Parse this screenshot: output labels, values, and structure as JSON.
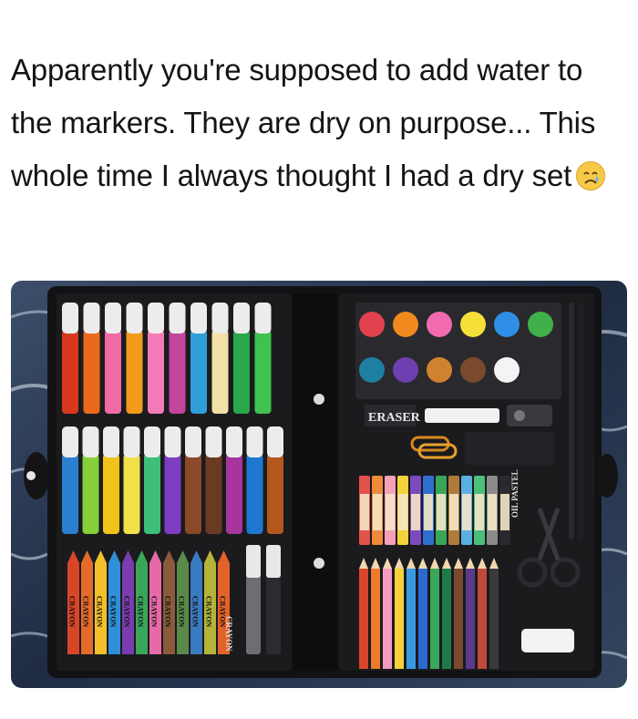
{
  "post": {
    "caption": "Apparently you're supposed to add water to the markers. They are dry on purpose... This whole time I always thought I had a dry set",
    "emoji": "crying-face"
  },
  "photo": {
    "subject": "art-set-case",
    "case_labels": {
      "eraser": "ERASER",
      "crayon": "CRAYON",
      "oil_pastel": "OIL PASTEL"
    },
    "colors": {
      "case": "#151517",
      "background_water": "#2a3a52",
      "markers_top": [
        "#d8381e",
        "#ea6a1c",
        "#f06aa6",
        "#f29a1a",
        "#f27bb8",
        "#c2469c",
        "#2f9fd8",
        "#f2e1a6",
        "#28a84a",
        "#3fc24f"
      ],
      "markers_bottom": [
        "#2b7fd0",
        "#86cf3a",
        "#f1c21a",
        "#f0e14a",
        "#3dbf7a",
        "#7d3ec1",
        "#8a4a2a",
        "#6b3a22",
        "#a6369c",
        "#1f78d0",
        "#b4581e"
      ],
      "paints_top": [
        "#e0434e",
        "#f08a1e",
        "#f26bb0",
        "#f5e03a",
        "#2f8fe6",
        "#3fb04a"
      ],
      "paints_bottom": [
        "#1f7fa0",
        "#6d3fb0",
        "#d0822e",
        "#7a4a2e",
        "#f4f4f4"
      ]
    }
  }
}
